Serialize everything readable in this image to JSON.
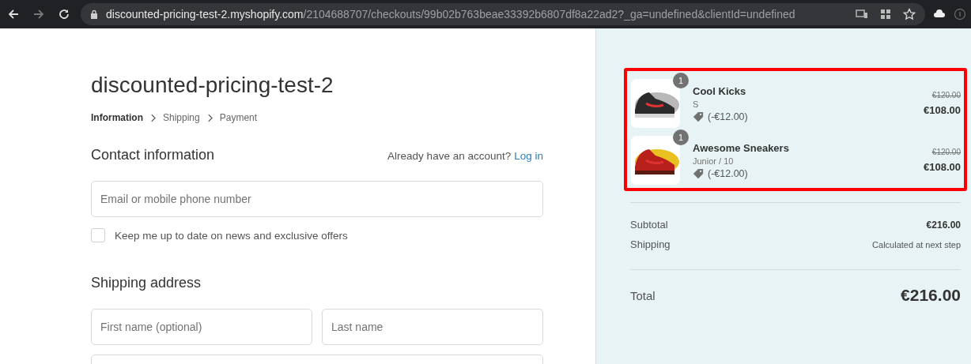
{
  "browser": {
    "url_host": "discounted-pricing-test-2.myshopify.com",
    "url_path": "/2104688707/checkouts/99b02b763beae33392b6807df8a22ad2?_ga=undefined&clientId=undefined"
  },
  "shop_title": "discounted-pricing-test-2",
  "breadcrumbs": [
    {
      "label": "Information",
      "selected": true
    },
    {
      "label": "Shipping",
      "selected": false
    },
    {
      "label": "Payment",
      "selected": false
    }
  ],
  "contact": {
    "heading": "Contact information",
    "account_prompt": "Already have an account?",
    "login_link": "Log in",
    "email": {
      "placeholder": "Email or mobile phone number"
    },
    "newsletter": {
      "label": "Keep me up to date on news and exclusive offers",
      "checked": false
    }
  },
  "shipping": {
    "heading": "Shipping address",
    "first_name": {
      "placeholder": "First name (optional)"
    },
    "last_name": {
      "placeholder": "Last name"
    }
  },
  "order": {
    "items": [
      {
        "quantity": "1",
        "name": "Cool Kicks",
        "variant": "S",
        "discount": "(-€12.00)",
        "original_price": "€120.00",
        "price": "€108.00",
        "kind": "grey"
      },
      {
        "quantity": "1",
        "name": "Awesome Sneakers",
        "variant": "Junior / 10",
        "discount": "(-€12.00)",
        "original_price": "€120.00",
        "price": "€108.00",
        "kind": "yellow"
      }
    ],
    "subtotal_label": "Subtotal",
    "subtotal": "€216.00",
    "shipping_label": "Shipping",
    "shipping_value": "Calculated at next step",
    "total_label": "Total",
    "total": "€216.00"
  }
}
